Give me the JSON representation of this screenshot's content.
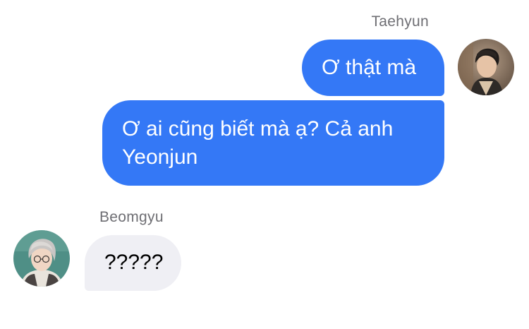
{
  "conversation": {
    "outgoing": {
      "sender_name": "Taehyun",
      "avatar_icon": "profile-photo-icon",
      "messages": [
        {
          "text": "Ơ thật mà"
        },
        {
          "text": "Ơ ai cũng biết mà ạ? Cả anh Yeonjun"
        }
      ]
    },
    "incoming": {
      "sender_name": "Beomgyu",
      "avatar_icon": "profile-photo-icon",
      "messages": [
        {
          "text": "?????"
        }
      ]
    }
  },
  "colors": {
    "outgoing_bubble": "#3478f6",
    "incoming_bubble": "#efeff4",
    "sender_name": "#6e6e73",
    "background": "#ffffff"
  }
}
